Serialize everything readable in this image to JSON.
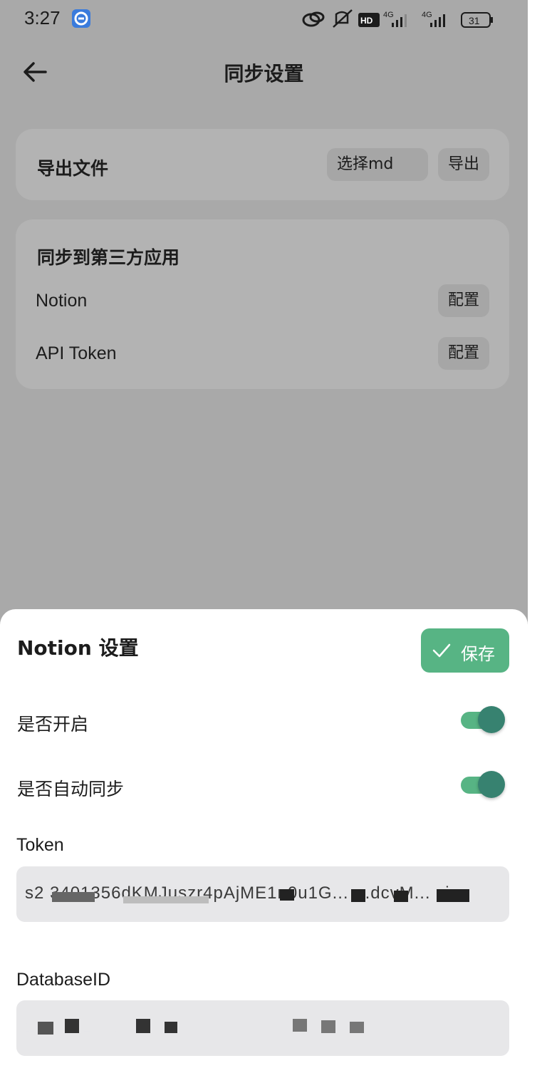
{
  "status_bar": {
    "time": "3:27",
    "battery": "31",
    "signal_1": "4G",
    "signal_2": "4G",
    "hd": "HD"
  },
  "header": {
    "title": "同步设置"
  },
  "export_card": {
    "title": "导出文件",
    "select_button": "选择md",
    "export_button": "导出"
  },
  "sync_card": {
    "title": "同步到第三方应用",
    "rows": [
      {
        "label": "Notion",
        "button": "配置"
      },
      {
        "label": "API Token",
        "button": "配置"
      }
    ]
  },
  "sheet": {
    "title": "Notion 设置",
    "save_label": "保存",
    "enable_label": "是否开启",
    "enable_state": true,
    "auto_sync_label": "是否自动同步",
    "auto_sync_state": true,
    "token_label": "Token",
    "token_value": "s2 3401356dKMJuszr4pAjME1n0u1G... ...dcvM... ci",
    "database_label": "DatabaseID",
    "database_value": "1f0a5e2a..."
  },
  "colors": {
    "accent": "#57b484",
    "toggle_knob": "#378270",
    "overlay_background": "#a9a9a9",
    "input_background": "#e7e7e9"
  }
}
